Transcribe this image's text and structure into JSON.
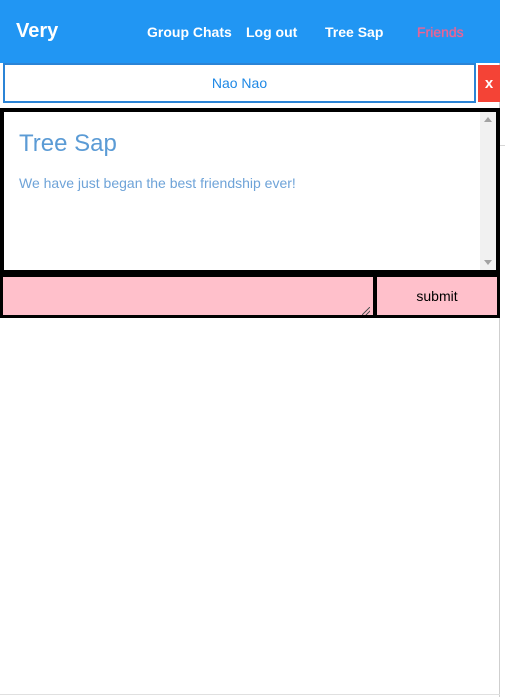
{
  "navbar": {
    "brand": "Very",
    "links": [
      {
        "label": "Group Chats"
      },
      {
        "label": "Log out"
      },
      {
        "label": "Tree Sap"
      },
      {
        "label": "Friends",
        "active": true
      }
    ]
  },
  "chat": {
    "name": "Nao Nao",
    "close_label": "x",
    "message": {
      "title": "Tree Sap",
      "text": "We have just began the best friendship ever!"
    }
  },
  "composer": {
    "input_value": "",
    "submit_label": "submit"
  },
  "colors": {
    "navbar_bg": "#2196f3",
    "active_link": "#f06292",
    "close_button": "#f44336",
    "composer_bg": "#ffc0cb"
  }
}
